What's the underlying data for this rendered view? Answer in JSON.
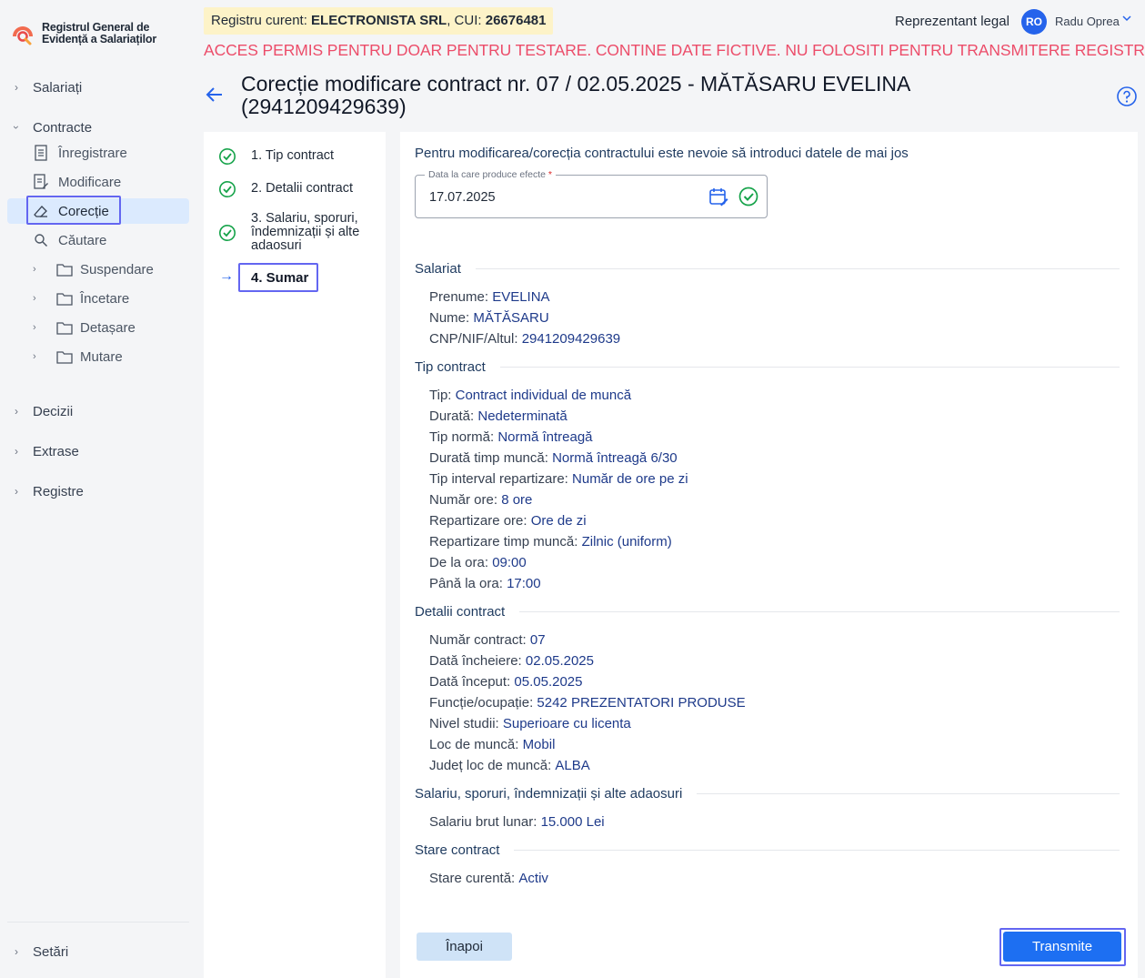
{
  "app": {
    "title_line1": "Registrul General de",
    "title_line2": "Evidență a Salariaților"
  },
  "sidebar": {
    "salariati": "Salariați",
    "contracte": "Contracte",
    "contracte_items": [
      "Înregistrare",
      "Modificare",
      "Corecție",
      "Căutare"
    ],
    "folders": [
      "Suspendare",
      "Încetare",
      "Detașare",
      "Mutare"
    ],
    "decizii": "Decizii",
    "extrase": "Extrase",
    "registre": "Registre",
    "setari": "Setări"
  },
  "topbar": {
    "registry_prefix": "Registru curent: ",
    "company": "ELECTRONISTA SRL",
    "cui_prefix": ", CUI: ",
    "cui": "26676481",
    "role": "Reprezentant legal",
    "avatar_initials": "RO",
    "user_name": "Radu Oprea",
    "warning": "ACCES PERMIS PENTRU DOAR PENTRU TESTARE. CONTINE DATE FICTIVE. NU FOLOSITI PENTRU TRANSMITERE REGISTRU"
  },
  "page": {
    "title": "Corecție modificare contract nr. 07 / 02.05.2025 - MĂTĂSARU  EVELINA (2941209429639)"
  },
  "steps": {
    "step1": "1. Tip contract",
    "step2": "2. Detalii contract",
    "step3": "3. Salariu, sporuri, îndemnizații și alte adaosuri",
    "step4": "4. Sumar"
  },
  "form": {
    "intro": "Pentru modificarea/corecția contractului este nevoie să introduci datele de mai jos",
    "date_label": "Data la care produce efecte",
    "date_required": "*",
    "date_value": "17.07.2025"
  },
  "summary": {
    "salariat_title": "Salariat",
    "prenume_label": "Prenume: ",
    "prenume": "EVELINA",
    "nume_label": "Nume: ",
    "nume": "MĂTĂSARU",
    "cnp_label": "CNP/NIF/Altul: ",
    "cnp": "2941209429639",
    "tip_title": "Tip contract",
    "tip_label": "Tip: ",
    "tip": "Contract individual de muncă",
    "durata_label": "Durată: ",
    "durata": "Nedeterminată",
    "norma_label": "Tip normă: ",
    "norma": "Normă întreagă",
    "durata_timp_label": "Durată timp muncă: ",
    "durata_timp": "Normă întreagă 6/30",
    "interval_label": "Tip interval repartizare: ",
    "interval": "Număr de ore pe zi",
    "nr_ore_label": "Număr ore: ",
    "nr_ore": "8 ore",
    "rep_ore_label": "Repartizare ore: ",
    "rep_ore": "Ore de zi",
    "rep_timp_label": "Repartizare timp muncă: ",
    "rep_timp": "Zilnic (uniform)",
    "de_la_label": "De la ora: ",
    "de_la": "09:00",
    "pana_label": "Până la ora: ",
    "pana": "17:00",
    "detalii_title": "Detalii contract",
    "nr_contract_label": "Număr contract: ",
    "nr_contract": "07",
    "data_incheiere_label": "Dată încheiere: ",
    "data_incheiere": "02.05.2025",
    "data_inceput_label": "Dată început: ",
    "data_inceput": "05.05.2025",
    "functie_label": "Funcție/ocupație: ",
    "functie": "5242 PREZENTATORI PRODUSE",
    "studii_label": "Nivel studii: ",
    "studii": "Superioare cu licenta",
    "loc_label": "Loc de muncă: ",
    "loc": "Mobil",
    "judet_label": "Județ loc de muncă: ",
    "judet": "ALBA",
    "salariu_title": "Salariu, sporuri, îndemnizații și alte adaosuri",
    "salariu_label": "Salariu brut lunar: ",
    "salariu": "15.000 Lei",
    "stare_title": "Stare contract",
    "stare_label": "Stare curentă: ",
    "stare": "Activ"
  },
  "actions": {
    "back": "Înapoi",
    "submit": "Transmite"
  },
  "colors": {
    "accent": "#1d6ff2",
    "warning": "#ec4d6a",
    "focus_outline": "#6366f1",
    "success": "#16a34a"
  }
}
